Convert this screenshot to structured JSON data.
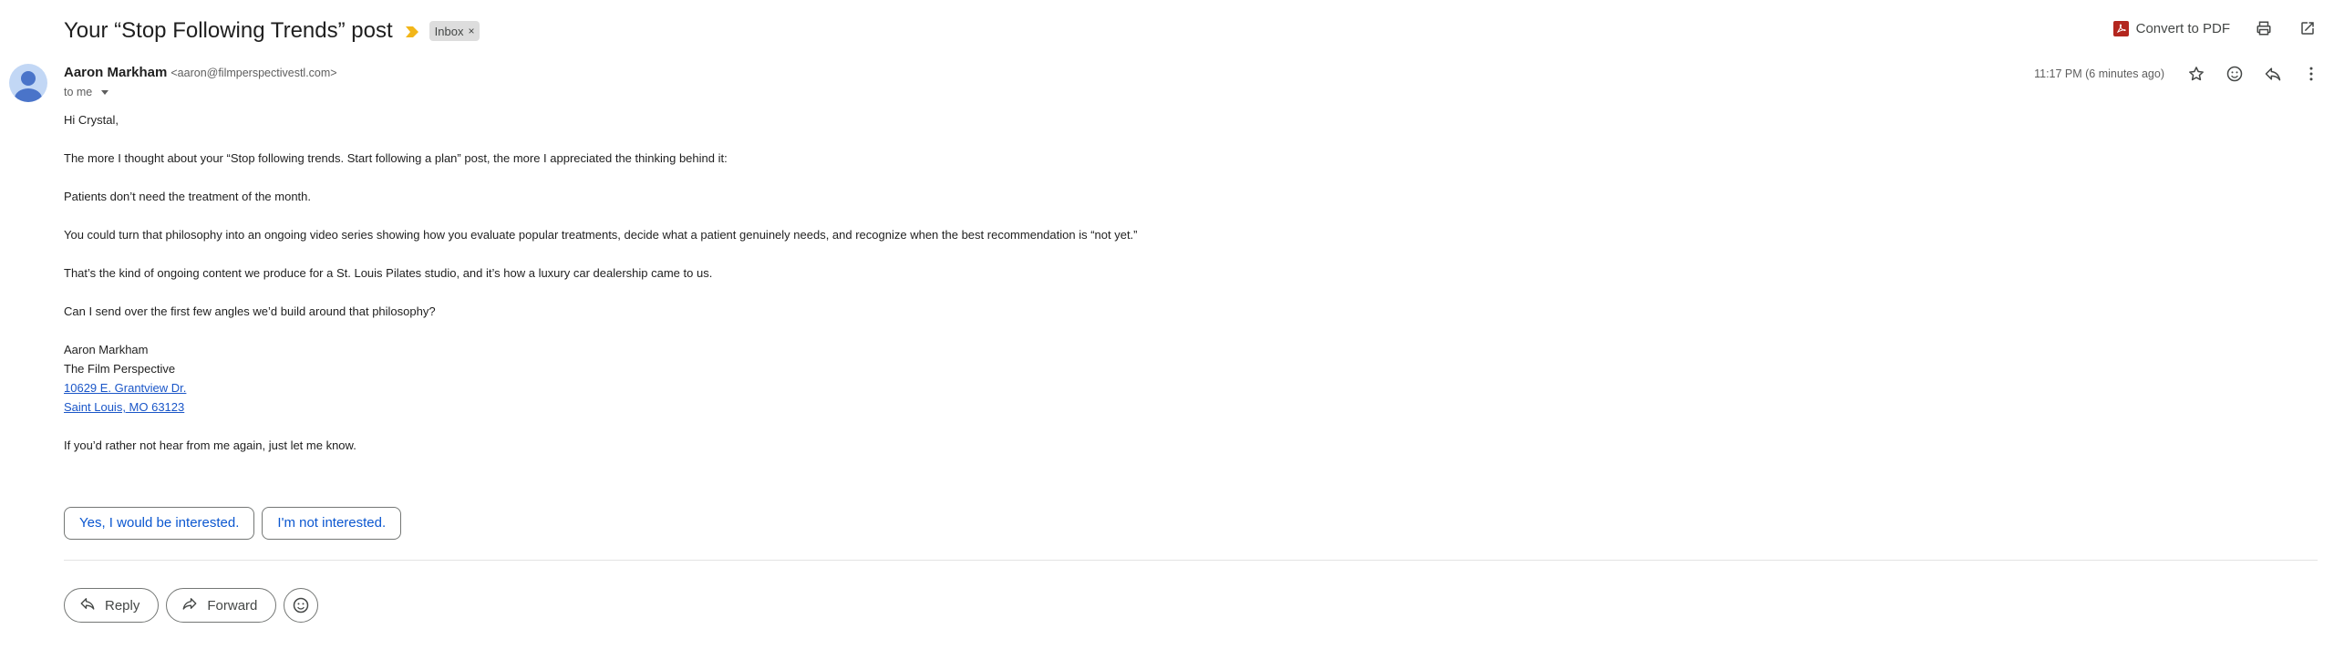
{
  "email": {
    "subject": "Your “Stop Following Trends” post",
    "label_chip": "Inbox",
    "label_remove": "×",
    "convert_pdf_label": "Convert to PDF",
    "sender_name": "Aaron Markham",
    "sender_email": "<aaron@filmperspectivestl.com>",
    "recipient_text": "to me",
    "timestamp": "11:17 PM (6 minutes ago)",
    "body": {
      "greeting": "Hi Crystal,",
      "p1": "The more I thought about your “Stop following trends. Start following a plan” post, the more I appreciated the thinking behind it:",
      "p2": "Patients don’t need the treatment of the month.",
      "p3": "You could turn that philosophy into an ongoing video series showing how you evaluate popular treatments, decide what a patient genuinely needs, and recognize when the best recommendation is “not yet.”",
      "p4": "That’s the kind of ongoing content we produce for a St. Louis Pilates studio, and it’s how a luxury car dealership came to us.",
      "p5": "Can I send over the first few angles we’d build around that philosophy?",
      "sig_name": "Aaron Markham",
      "sig_company": "The Film Perspective",
      "sig_address1": "10629 E. Grantview Dr.",
      "sig_address2": "Saint Louis, MO 63123",
      "p6": "If you’d rather not hear from me again, just let me know."
    },
    "smart_replies": [
      "Yes, I would be interested.",
      "I'm not interested."
    ],
    "actions": {
      "reply": "Reply",
      "forward": "Forward"
    }
  },
  "icons": {
    "importance": "importance-marker-icon",
    "pdf": "pdf-icon",
    "print": "print-icon",
    "open_new_window": "open-in-new-icon",
    "star": "star-icon",
    "emoji": "emoji-icon",
    "reply": "reply-icon",
    "more": "more-vert-icon",
    "forward": "forward-icon"
  },
  "colors": {
    "link": "#1a56c8",
    "chip_text": "#0b57d0",
    "importance": "#f2b619",
    "pdf": "#b3261e"
  }
}
